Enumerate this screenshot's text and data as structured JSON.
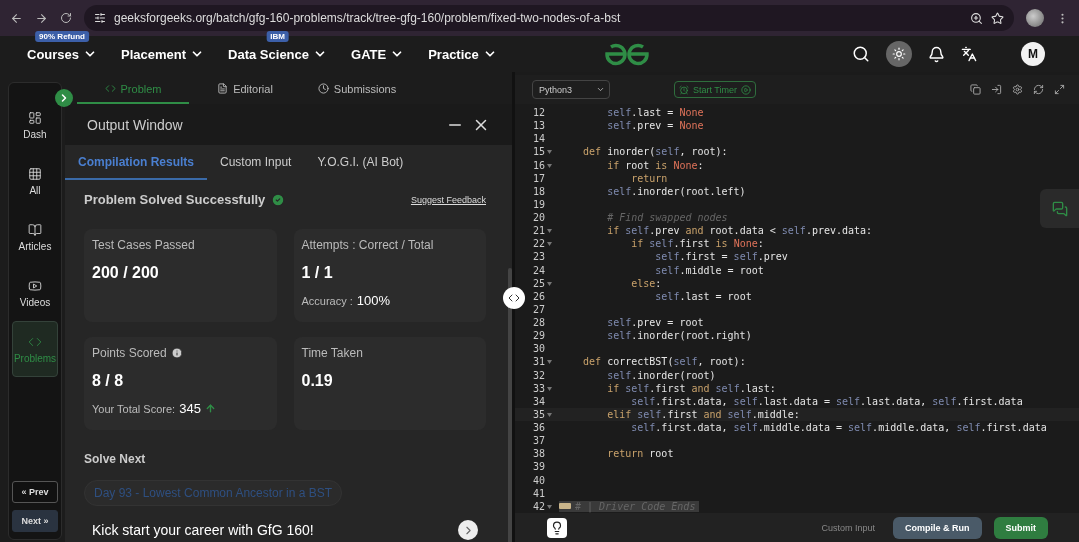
{
  "browser": {
    "url": "geeksforgeeks.org/batch/gfg-160-problems/track/tree-gfg-160/problem/fixed-two-nodes-of-a-bst"
  },
  "site_nav": {
    "items": [
      {
        "label": "Courses",
        "badge": "90% Refund"
      },
      {
        "label": "Placement"
      },
      {
        "label": "Data Science",
        "badge": "IBM"
      },
      {
        "label": "GATE"
      },
      {
        "label": "Practice"
      }
    ],
    "avatar": "M"
  },
  "sidebar": {
    "items": [
      {
        "label": "Dash",
        "selected": false
      },
      {
        "label": "All",
        "selected": false
      },
      {
        "label": "Articles",
        "selected": false
      },
      {
        "label": "Videos",
        "selected": false
      },
      {
        "label": "Problems",
        "selected": true
      }
    ],
    "prev": "« Prev",
    "next": "Next »"
  },
  "problem_tabs": [
    {
      "label": "Problem",
      "selected": true
    },
    {
      "label": "Editorial",
      "selected": false
    },
    {
      "label": "Submissions",
      "selected": false
    }
  ],
  "output_window": {
    "title": "Output Window",
    "tabs": [
      {
        "label": "Compilation Results",
        "selected": true
      },
      {
        "label": "Custom Input",
        "selected": false
      },
      {
        "label": "Y.O.G.I. (AI Bot)",
        "selected": false
      }
    ],
    "status": "Problem Solved Successfully",
    "feedback_link": "Suggest Feedback",
    "cards": [
      {
        "label": "Test Cases Passed",
        "value": "200 / 200"
      },
      {
        "label": "Attempts : Correct / Total",
        "value": "1 / 1",
        "footer_label": "Accuracy :",
        "footer_value": "100%"
      },
      {
        "label": "Points Scored",
        "info_icon": true,
        "value": "8 / 8",
        "footer_label": "Your Total Score:",
        "footer_value": "345",
        "trend_up": true
      },
      {
        "label": "Time Taken",
        "value": "0.19"
      }
    ],
    "solve_next": "Solve Next",
    "next_problem": "Day 93 - Lowest Common Ancestor in a BST",
    "promo": "Kick start your career with GfG 160!"
  },
  "editor": {
    "language": "Python3",
    "timer": "Start Timer",
    "lines": [
      {
        "number": "12",
        "tokens": [
          {
            "text": "        self",
            "kind": "self"
          },
          {
            "text": ".last = ",
            "kind": "plain"
          },
          {
            "text": "None",
            "kind": "const"
          }
        ]
      },
      {
        "number": "13",
        "tokens": [
          {
            "text": "        self",
            "kind": "self"
          },
          {
            "text": ".prev = ",
            "kind": "plain"
          },
          {
            "text": "None",
            "kind": "const"
          }
        ]
      },
      {
        "number": "14"
      },
      {
        "number": "15",
        "foldable": true,
        "tokens": [
          {
            "text": "    def",
            "kind": "kw"
          },
          {
            "text": " inorder(",
            "kind": "plain"
          },
          {
            "text": "self",
            "kind": "self"
          },
          {
            "text": ", root):",
            "kind": "plain"
          }
        ]
      },
      {
        "number": "16",
        "foldable": true,
        "tokens": [
          {
            "text": "        if",
            "kind": "kw"
          },
          {
            "text": " root ",
            "kind": "plain"
          },
          {
            "text": "is",
            "kind": "kw"
          },
          {
            "text": " None",
            "kind": "const"
          },
          {
            "text": ":",
            "kind": "plain"
          }
        ]
      },
      {
        "number": "17",
        "tokens": [
          {
            "text": "            return",
            "kind": "kw"
          }
        ]
      },
      {
        "number": "18",
        "tokens": [
          {
            "text": "        self",
            "kind": "self"
          },
          {
            "text": ".inorder(root.left)",
            "kind": "plain"
          }
        ]
      },
      {
        "number": "19"
      },
      {
        "number": "20",
        "tokens": [
          {
            "text": "        # Find swapped nodes",
            "kind": "comment"
          }
        ]
      },
      {
        "number": "21",
        "foldable": true,
        "tokens": [
          {
            "text": "        if",
            "kind": "kw"
          },
          {
            "text": " self",
            "kind": "self"
          },
          {
            "text": ".prev ",
            "kind": "plain"
          },
          {
            "text": "and",
            "kind": "kw"
          },
          {
            "text": " root.data < ",
            "kind": "plain"
          },
          {
            "text": "self",
            "kind": "self"
          },
          {
            "text": ".prev.data:",
            "kind": "plain"
          }
        ]
      },
      {
        "number": "22",
        "foldable": true,
        "tokens": [
          {
            "text": "            if",
            "kind": "kw"
          },
          {
            "text": " self",
            "kind": "self"
          },
          {
            "text": ".first ",
            "kind": "plain"
          },
          {
            "text": "is",
            "kind": "kw"
          },
          {
            "text": " None",
            "kind": "const"
          },
          {
            "text": ":",
            "kind": "plain"
          }
        ]
      },
      {
        "number": "23",
        "tokens": [
          {
            "text": "                self",
            "kind": "self"
          },
          {
            "text": ".first = ",
            "kind": "plain"
          },
          {
            "text": "self",
            "kind": "self"
          },
          {
            "text": ".prev",
            "kind": "plain"
          }
        ]
      },
      {
        "number": "24",
        "tokens": [
          {
            "text": "                self",
            "kind": "self"
          },
          {
            "text": ".middle = root",
            "kind": "plain"
          }
        ]
      },
      {
        "number": "25",
        "foldable": true,
        "tokens": [
          {
            "text": "            else",
            "kind": "kw"
          },
          {
            "text": ":",
            "kind": "plain"
          }
        ]
      },
      {
        "number": "26",
        "tokens": [
          {
            "text": "                self",
            "kind": "self"
          },
          {
            "text": ".last = root",
            "kind": "plain"
          }
        ]
      },
      {
        "number": "27"
      },
      {
        "number": "28",
        "tokens": [
          {
            "text": "        self",
            "kind": "self"
          },
          {
            "text": ".prev = root",
            "kind": "plain"
          }
        ]
      },
      {
        "number": "29",
        "tokens": [
          {
            "text": "        self",
            "kind": "self"
          },
          {
            "text": ".inorder(root.right)",
            "kind": "plain"
          }
        ]
      },
      {
        "number": "30"
      },
      {
        "number": "31",
        "foldable": true,
        "tokens": [
          {
            "text": "    def",
            "kind": "kw"
          },
          {
            "text": " correctBST(",
            "kind": "plain"
          },
          {
            "text": "self",
            "kind": "self"
          },
          {
            "text": ", root):",
            "kind": "plain"
          }
        ]
      },
      {
        "number": "32",
        "tokens": [
          {
            "text": "        self",
            "kind": "self"
          },
          {
            "text": ".inorder(root)",
            "kind": "plain"
          }
        ]
      },
      {
        "number": "33",
        "foldable": true,
        "tokens": [
          {
            "text": "        if",
            "kind": "kw"
          },
          {
            "text": " self",
            "kind": "self"
          },
          {
            "text": ".first ",
            "kind": "plain"
          },
          {
            "text": "and",
            "kind": "kw"
          },
          {
            "text": " self",
            "kind": "self"
          },
          {
            "text": ".last:",
            "kind": "plain"
          }
        ]
      },
      {
        "number": "34",
        "tokens": [
          {
            "text": "            self",
            "kind": "self"
          },
          {
            "text": ".first.data, ",
            "kind": "plain"
          },
          {
            "text": "self",
            "kind": "self"
          },
          {
            "text": ".last.data = ",
            "kind": "plain"
          },
          {
            "text": "self",
            "kind": "self"
          },
          {
            "text": ".last.data, ",
            "kind": "plain"
          },
          {
            "text": "self",
            "kind": "self"
          },
          {
            "text": ".first.data",
            "kind": "plain"
          }
        ]
      },
      {
        "number": "35",
        "foldable": true,
        "active": true,
        "tokens": [
          {
            "text": "        elif",
            "kind": "kw"
          },
          {
            "text": " self",
            "kind": "self"
          },
          {
            "text": ".first ",
            "kind": "plain"
          },
          {
            "text": "and",
            "kind": "kw"
          },
          {
            "text": " self",
            "kind": "self"
          },
          {
            "text": ".middle:",
            "kind": "plain"
          }
        ]
      },
      {
        "number": "36",
        "tokens": [
          {
            "text": "            self",
            "kind": "self"
          },
          {
            "text": ".first.data, ",
            "kind": "plain"
          },
          {
            "text": "self",
            "kind": "self"
          },
          {
            "text": ".middle.data = ",
            "kind": "plain"
          },
          {
            "text": "self",
            "kind": "self"
          },
          {
            "text": ".middle.data, ",
            "kind": "plain"
          },
          {
            "text": "self",
            "kind": "self"
          },
          {
            "text": ".first.data",
            "kind": "plain"
          }
        ]
      },
      {
        "number": "37"
      },
      {
        "number": "38",
        "tokens": [
          {
            "text": "        return",
            "kind": "kw"
          },
          {
            "text": " root",
            "kind": "plain"
          }
        ]
      },
      {
        "number": "39"
      },
      {
        "number": "40"
      },
      {
        "number": "41"
      },
      {
        "number": "42",
        "foldable": true,
        "folded": true,
        "tokens": [
          {
            "text": "# | Driver Code Ends",
            "kind": "comment"
          }
        ]
      }
    ],
    "custom_input": "Custom Input",
    "compile": "Compile & Run",
    "submit": "Submit"
  }
}
